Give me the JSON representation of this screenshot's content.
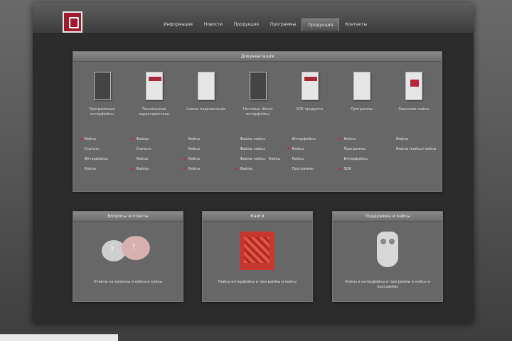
{
  "header": {
    "nav": [
      "Информация",
      "Новости",
      "Продукция",
      "Программы",
      "Продукция",
      "Контакты"
    ],
    "active_index": 4
  },
  "documents": {
    "title": "Документация",
    "columns": [
      {
        "name": "Программные интерфейсы",
        "thumb": "dark",
        "links": [
          [
            "Кейсы",
            true
          ],
          [
            "Скачать",
            false
          ],
          [
            "Интерфейсы",
            false
          ],
          [
            "Кейсы",
            false
          ]
        ]
      },
      {
        "name": "Технические характеристики",
        "thumb": "mixed",
        "links": [
          [
            "Файлы",
            true
          ],
          [
            "Скачать",
            false
          ],
          [
            "Кейсы",
            false
          ],
          [
            "Файлы",
            true
          ]
        ]
      },
      {
        "name": "Схемы подключения",
        "thumb": "plain",
        "links": [
          [
            "Кейсы",
            false
          ],
          [
            "Кейсы",
            false
          ],
          [
            "Кейсы",
            true
          ],
          [
            "Кейсы",
            true
          ]
        ]
      },
      {
        "name": "Тестовые (бета) интерфейсы",
        "thumb": "dark",
        "links": [
          [
            "Файлы кейсы",
            false
          ],
          [
            "Файлы кейсы",
            false
          ],
          [
            "Файлы кейсы · Кейсы",
            false
          ],
          [
            "Файлы",
            true
          ]
        ]
      },
      {
        "name": "SDK продукты",
        "thumb": "mixed",
        "links": [
          [
            "Интерфейсы",
            false
          ],
          [
            "Кейсы",
            true
          ],
          [
            "Кейсы",
            false
          ],
          [
            "Программы",
            false
          ]
        ]
      },
      {
        "name": "Программы",
        "thumb": "plain",
        "links": [
          [
            "Кейсы",
            true
          ],
          [
            "Программы",
            false
          ],
          [
            "Интерфейсы",
            false
          ],
          [
            "SDK",
            true
          ]
        ]
      },
      {
        "name": "Лицензия кейсы",
        "thumb": "red",
        "links": [
          [
            "Файлы",
            false
          ],
          [
            "Файлы (кейсы) кейсы",
            false
          ]
        ]
      }
    ]
  },
  "cards": [
    {
      "title": "Вопросы и ответы",
      "caption": "Ответы на вопросы и кейсы и кейсы",
      "art": "bubbles"
    },
    {
      "title": "Книги",
      "caption": "Кейсы интерфейсы и программы и кейсы",
      "art": "book"
    },
    {
      "title": "Поддержка и кейсы",
      "caption": "Кейсы и интерфейсы и программы и кейсы и программы",
      "art": "owl"
    }
  ],
  "colors": {
    "accent": "#b3263a",
    "panel": "#676767",
    "frame": "#2c2c2c"
  }
}
